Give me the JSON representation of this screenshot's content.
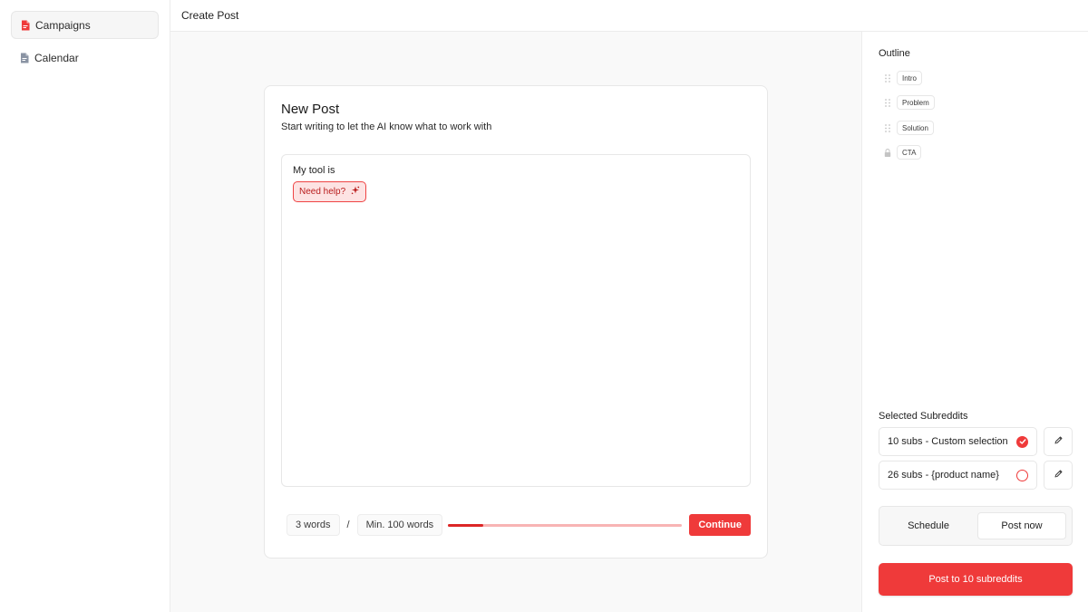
{
  "colors": {
    "accent": "#ef3a3a",
    "accent_light": "#fde3e3",
    "border": "#e7e7e7"
  },
  "sidebar": {
    "items": [
      {
        "label": "Campaigns",
        "icon": "document-red-icon",
        "active": true
      },
      {
        "label": "Calendar",
        "icon": "document-icon",
        "active": false
      }
    ]
  },
  "header": {
    "title": "Create Post"
  },
  "post": {
    "title": "New Post",
    "subtitle": "Start writing to let the AI know what to work with",
    "editor_text": "My tool is",
    "help_label": "Need help?",
    "word_count": "3 words",
    "separator": "/",
    "min_words": "Min. 100 words",
    "progress": 0.15,
    "continue_label": "Continue"
  },
  "outline": {
    "title": "Outline",
    "items": [
      {
        "label": "Intro",
        "locked": false
      },
      {
        "label": "Problem",
        "locked": false
      },
      {
        "label": "Solution",
        "locked": false
      },
      {
        "label": "CTA",
        "locked": true
      }
    ]
  },
  "subreddits": {
    "title": "Selected Subreddits",
    "options": [
      {
        "label": "10 subs - Custom selection",
        "selected": true
      },
      {
        "label": "26 subs - {product name}",
        "selected": false
      }
    ]
  },
  "schedule": {
    "options": [
      "Schedule",
      "Post now"
    ],
    "selected": "Post now"
  },
  "post_button": "Post to 10 subreddits"
}
